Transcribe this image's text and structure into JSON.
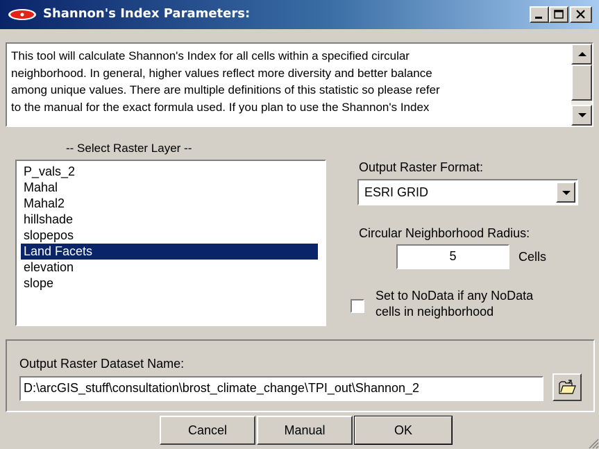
{
  "window": {
    "title": "Shannon's Index Parameters:",
    "colors": {
      "titlebar_start": "#0a246a",
      "titlebar_end": "#a6caf0",
      "face": "#d4d0c8",
      "selection": "#0a246a"
    },
    "controls": [
      "minimize-icon",
      "maximize-icon",
      "close-icon"
    ]
  },
  "description": {
    "text": "This tool will calculate Shannon's Index for all cells within a specified circular\nneighborhood.  In general, higher values reflect more diversity and better balance\namong unique values.  There are multiple definitions of this statistic so please refer\nto the manual for the exact formula used.  If you plan to use the Shannon's Index"
  },
  "raster_select": {
    "label": "-- Select Raster Layer --",
    "items": [
      {
        "label": "P_vals_2",
        "selected": false
      },
      {
        "label": "Mahal",
        "selected": false
      },
      {
        "label": "Mahal2",
        "selected": false
      },
      {
        "label": "hillshade",
        "selected": false
      },
      {
        "label": "slopepos",
        "selected": false
      },
      {
        "label": "Land Facets",
        "selected": true
      },
      {
        "label": "elevation",
        "selected": false
      },
      {
        "label": "slope",
        "selected": false
      }
    ]
  },
  "format": {
    "label": "Output Raster Format:",
    "value": "ESRI GRID"
  },
  "radius": {
    "label": "Circular Neighborhood Radius:",
    "value": "5",
    "unit": "Cells"
  },
  "nodata": {
    "label": "Set to NoData if any NoData\ncells in neighborhood",
    "checked": false
  },
  "output": {
    "label": "Output Raster Dataset Name:",
    "value": "D:\\arcGIS_stuff\\consultation\\brost_climate_change\\TPI_out\\Shannon_2",
    "browse_icon": "open-folder-icon"
  },
  "buttons": {
    "cancel": "Cancel",
    "manual": "Manual",
    "ok": "OK"
  }
}
